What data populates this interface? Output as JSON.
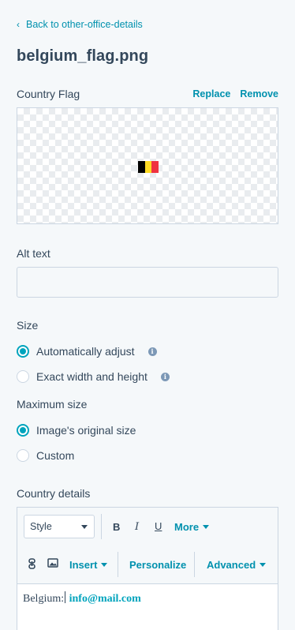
{
  "back_link": "Back to other-office-details",
  "file_name": "belgium_flag.png",
  "country_flag": {
    "label": "Country Flag",
    "replace_label": "Replace",
    "remove_label": "Remove",
    "flag_colors": [
      "#000000",
      "#fdda24",
      "#ef3340"
    ]
  },
  "alt_text": {
    "label": "Alt text",
    "value": "",
    "placeholder": ""
  },
  "size": {
    "label": "Size",
    "options": [
      {
        "label": "Automatically adjust",
        "checked": true
      },
      {
        "label": "Exact width and height",
        "checked": false
      }
    ]
  },
  "max_size": {
    "label": "Maximum size",
    "options": [
      {
        "label": "Image's original size",
        "checked": true
      },
      {
        "label": "Custom",
        "checked": false
      }
    ]
  },
  "country_details": {
    "label": "Country details",
    "toolbar": {
      "style_label": "Style",
      "bold": "B",
      "italic": "I",
      "underline": "U",
      "more": "More",
      "insert": "Insert",
      "personalize": "Personalize",
      "advanced": "Advanced"
    },
    "content_prefix": "Belgium:",
    "content_email": "info@mail.com"
  },
  "colors": {
    "accent": "#0091ae",
    "radio": "#00a4bd",
    "text": "#33475b"
  }
}
